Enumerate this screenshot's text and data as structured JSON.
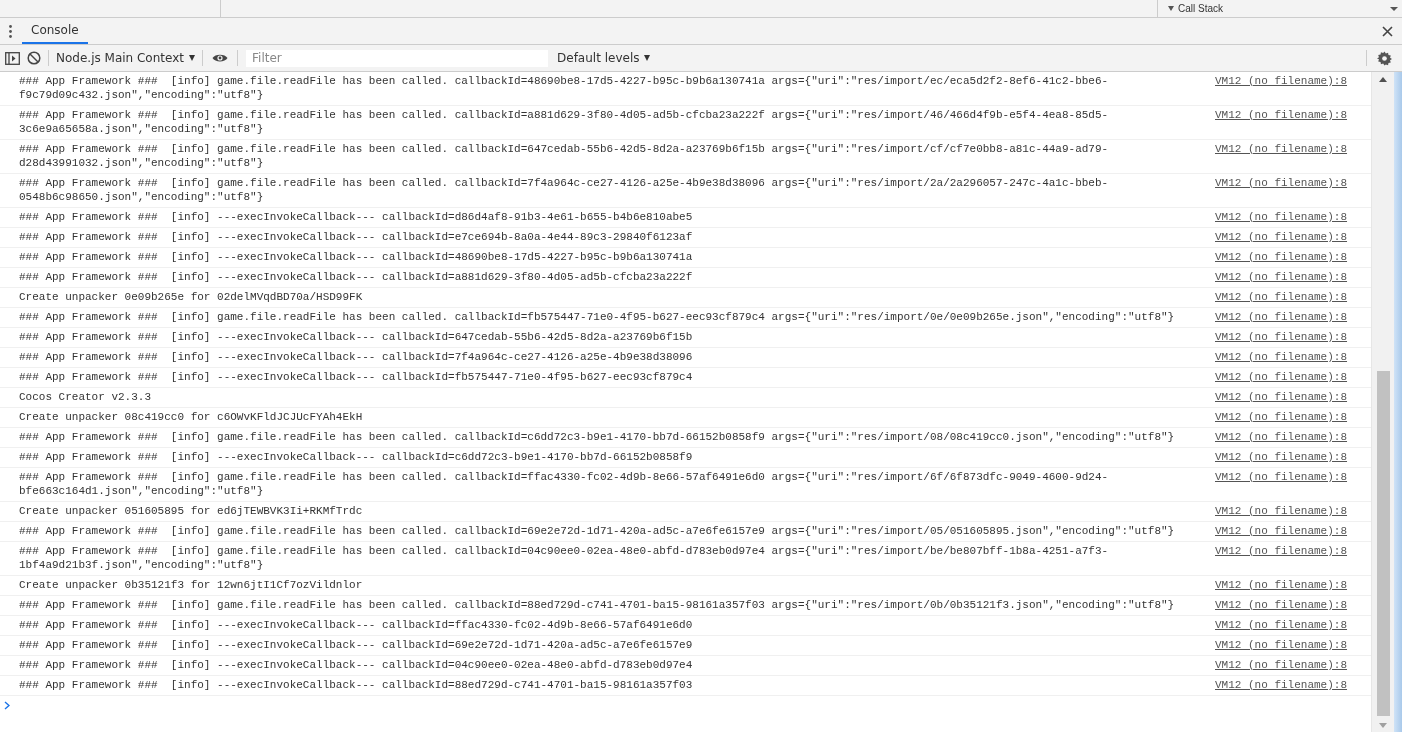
{
  "top_panel": {
    "section": "Call Stack",
    "expanded": true
  },
  "tabs": [
    {
      "label": "Console",
      "selected": true
    }
  ],
  "toolbar": {
    "context": "Node.js Main Context",
    "filter": {
      "placeholder": "Filter"
    },
    "levels": "Default levels"
  },
  "messages": [
    {
      "text": "### App Framework ###  [info] game.file.readFile has been called. callbackId=48690be8-17d5-4227-b95c-b9b6a130741a args={\"uri\":\"res/import/ec/eca5d2f2-8ef6-41c2-bbe6-f9c79d09c432.json\",\"encoding\":\"utf8\"}",
      "source": "VM12 (no filename):8"
    },
    {
      "text": "### App Framework ###  [info] game.file.readFile has been called. callbackId=a881d629-3f80-4d05-ad5b-cfcba23a222f args={\"uri\":\"res/import/46/466d4f9b-e5f4-4ea8-85d5-3c6e9a65658a.json\",\"encoding\":\"utf8\"}",
      "source": "VM12 (no filename):8"
    },
    {
      "text": "### App Framework ###  [info] game.file.readFile has been called. callbackId=647cedab-55b6-42d5-8d2a-a23769b6f15b args={\"uri\":\"res/import/cf/cf7e0bb8-a81c-44a9-ad79-d28d43991032.json\",\"encoding\":\"utf8\"}",
      "source": "VM12 (no filename):8"
    },
    {
      "text": "### App Framework ###  [info] game.file.readFile has been called. callbackId=7f4a964c-ce27-4126-a25e-4b9e38d38096 args={\"uri\":\"res/import/2a/2a296057-247c-4a1c-bbeb-0548b6c98650.json\",\"encoding\":\"utf8\"}",
      "source": "VM12 (no filename):8"
    },
    {
      "text": "### App Framework ###  [info] ---execInvokeCallback--- callbackId=d86d4af8-91b3-4e61-b655-b4b6e810abe5",
      "source": "VM12 (no filename):8"
    },
    {
      "text": "### App Framework ###  [info] ---execInvokeCallback--- callbackId=e7ce694b-8a0a-4e44-89c3-29840f6123af",
      "source": "VM12 (no filename):8"
    },
    {
      "text": "### App Framework ###  [info] ---execInvokeCallback--- callbackId=48690be8-17d5-4227-b95c-b9b6a130741a",
      "source": "VM12 (no filename):8"
    },
    {
      "text": "### App Framework ###  [info] ---execInvokeCallback--- callbackId=a881d629-3f80-4d05-ad5b-cfcba23a222f",
      "source": "VM12 (no filename):8"
    },
    {
      "text": "Create unpacker 0e09b265e for 02delMVqdBD70a/HSD99FK",
      "source": "VM12 (no filename):8"
    },
    {
      "text": "### App Framework ###  [info] game.file.readFile has been called. callbackId=fb575447-71e0-4f95-b627-eec93cf879c4 args={\"uri\":\"res/import/0e/0e09b265e.json\",\"encoding\":\"utf8\"}",
      "source": "VM12 (no filename):8"
    },
    {
      "text": "### App Framework ###  [info] ---execInvokeCallback--- callbackId=647cedab-55b6-42d5-8d2a-a23769b6f15b",
      "source": "VM12 (no filename):8"
    },
    {
      "text": "### App Framework ###  [info] ---execInvokeCallback--- callbackId=7f4a964c-ce27-4126-a25e-4b9e38d38096",
      "source": "VM12 (no filename):8"
    },
    {
      "text": "### App Framework ###  [info] ---execInvokeCallback--- callbackId=fb575447-71e0-4f95-b627-eec93cf879c4",
      "source": "VM12 (no filename):8"
    },
    {
      "text": "Cocos Creator v2.3.3",
      "source": "VM12 (no filename):8"
    },
    {
      "text": "Create unpacker 08c419cc0 for c6OWvKFldJCJUcFYAh4EkH",
      "source": "VM12 (no filename):8"
    },
    {
      "text": "### App Framework ###  [info] game.file.readFile has been called. callbackId=c6dd72c3-b9e1-4170-bb7d-66152b0858f9 args={\"uri\":\"res/import/08/08c419cc0.json\",\"encoding\":\"utf8\"}",
      "source": "VM12 (no filename):8"
    },
    {
      "text": "### App Framework ###  [info] ---execInvokeCallback--- callbackId=c6dd72c3-b9e1-4170-bb7d-66152b0858f9",
      "source": "VM12 (no filename):8"
    },
    {
      "text": "### App Framework ###  [info] game.file.readFile has been called. callbackId=ffac4330-fc02-4d9b-8e66-57af6491e6d0 args={\"uri\":\"res/import/6f/6f873dfc-9049-4600-9d24-bfe663c164d1.json\",\"encoding\":\"utf8\"}",
      "source": "VM12 (no filename):8"
    },
    {
      "text": "Create unpacker 051605895 for ed6jTEWBVK3Ii+RKMfTrdc",
      "source": "VM12 (no filename):8"
    },
    {
      "text": "### App Framework ###  [info] game.file.readFile has been called. callbackId=69e2e72d-1d71-420a-ad5c-a7e6fe6157e9 args={\"uri\":\"res/import/05/051605895.json\",\"encoding\":\"utf8\"}",
      "source": "VM12 (no filename):8"
    },
    {
      "text": "### App Framework ###  [info] game.file.readFile has been called. callbackId=04c90ee0-02ea-48e0-abfd-d783eb0d97e4 args={\"uri\":\"res/import/be/be807bff-1b8a-4251-a7f3-1bf4a9d21b3f.json\",\"encoding\":\"utf8\"}",
      "source": "VM12 (no filename):8"
    },
    {
      "text": "Create unpacker 0b35121f3 for 12wn6jtI1Cf7ozVildnlor",
      "source": "VM12 (no filename):8"
    },
    {
      "text": "### App Framework ###  [info] game.file.readFile has been called. callbackId=88ed729d-c741-4701-ba15-98161a357f03 args={\"uri\":\"res/import/0b/0b35121f3.json\",\"encoding\":\"utf8\"}",
      "source": "VM12 (no filename):8"
    },
    {
      "text": "### App Framework ###  [info] ---execInvokeCallback--- callbackId=ffac4330-fc02-4d9b-8e66-57af6491e6d0",
      "source": "VM12 (no filename):8"
    },
    {
      "text": "### App Framework ###  [info] ---execInvokeCallback--- callbackId=69e2e72d-1d71-420a-ad5c-a7e6fe6157e9",
      "source": "VM12 (no filename):8"
    },
    {
      "text": "### App Framework ###  [info] ---execInvokeCallback--- callbackId=04c90ee0-02ea-48e0-abfd-d783eb0d97e4",
      "source": "VM12 (no filename):8"
    },
    {
      "text": "### App Framework ###  [info] ---execInvokeCallback--- callbackId=88ed729d-c741-4701-ba15-98161a357f03",
      "source": "VM12 (no filename):8"
    }
  ]
}
